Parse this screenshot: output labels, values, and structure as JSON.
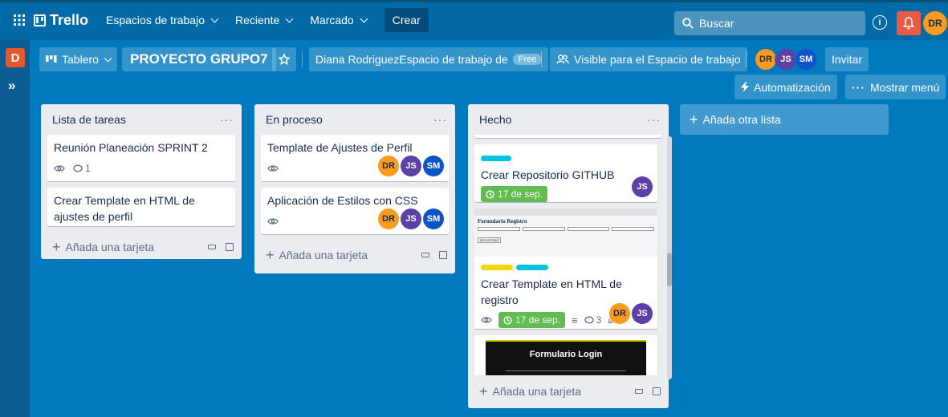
{
  "header": {
    "logo": "Trello",
    "nav": [
      {
        "label": "Espacios de trabajo"
      },
      {
        "label": "Reciente"
      },
      {
        "label": "Marcado"
      }
    ],
    "create": "Crear",
    "search_placeholder": "Buscar",
    "user_initials": "DR"
  },
  "sidebar": {
    "workspace_initial": "D",
    "expand": "»"
  },
  "board": {
    "view_label": "Tablero",
    "title": "PROYECTO GRUPO7",
    "workspace_label": "Diana RodriguezEspacio de trabajo de",
    "plan_badge": "Free",
    "visibility_label": "Visible para el Espacio de trabajo",
    "members": [
      "DR",
      "JS",
      "SM"
    ],
    "invite": "Invitar",
    "automation": "Automatización",
    "menu": "Mostrar menú"
  },
  "lists": [
    {
      "title": "Lista de tareas",
      "cards": [
        {
          "title": "Reunión Planeación SPRINT 2",
          "comments": "1"
        },
        {
          "title": "Crear Template en HTML de ajustes de perfil"
        }
      ],
      "add_card": "Añada una tarjeta"
    },
    {
      "title": "En proceso",
      "cards": [
        {
          "title": "Template de Ajustes de Perfil",
          "members": [
            "DR",
            "JS",
            "SM"
          ]
        },
        {
          "title": "Aplicación de Estilos con CSS",
          "members": [
            "DR",
            "JS",
            "SM"
          ]
        }
      ],
      "add_card": "Añada una tarjeta"
    },
    {
      "title": "Hecho",
      "cards": [
        {
          "title": "Crear Repositorio GITHUB",
          "due": "17 de sep.",
          "members": [
            "JS"
          ]
        },
        {
          "cover_title": "Formulario Registro",
          "cover_button": "REGISTRAR",
          "title": "Crear Template en HTML de registro",
          "due": "17 de sep.",
          "comments": "3",
          "attachments": "1",
          "members": [
            "DR",
            "JS"
          ]
        },
        {
          "cover_title": "Formulario Login"
        }
      ],
      "add_card": "Añada una tarjeta"
    }
  ],
  "add_list": "Añada otra lista",
  "colors": {
    "board_bg": "#0079bf",
    "header_bg": "#026aa7",
    "label_cyan": "#00c2e0",
    "label_yellow": "#f2d600",
    "due_green": "#61bd4f",
    "bell_red": "#eb5a46"
  }
}
